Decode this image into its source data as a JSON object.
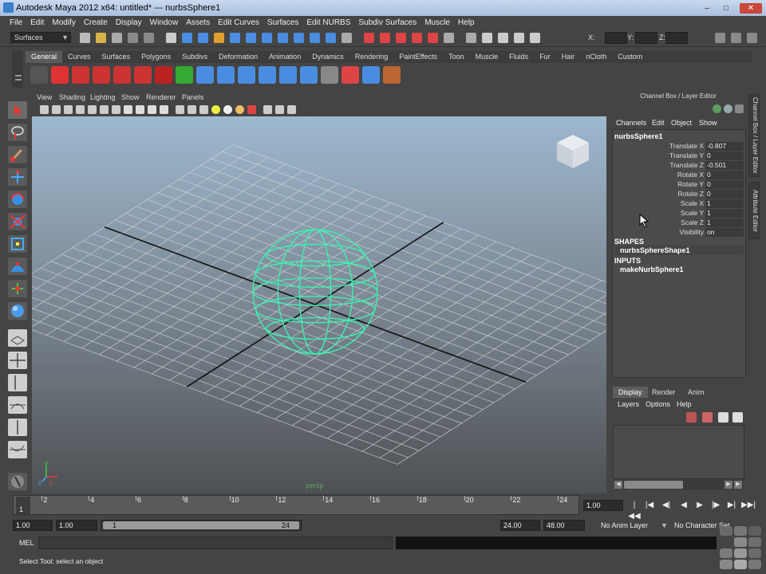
{
  "window": {
    "title": "Autodesk Maya 2012 x64: untitled*   ---   nurbsSphere1",
    "controls": [
      "minimize-icon",
      "maximize-icon",
      "close-icon"
    ]
  },
  "menubar": [
    "File",
    "Edit",
    "Modify",
    "Create",
    "Display",
    "Window",
    "Assets",
    "Edit Curves",
    "Surfaces",
    "Edit NURBS",
    "Subdiv Surfaces",
    "Muscle",
    "Help"
  ],
  "statusline": {
    "menuset": "Surfaces",
    "coord_labels": [
      "X:",
      "Y:",
      "Z:"
    ]
  },
  "shelf": {
    "tabs": [
      "General",
      "Curves",
      "Surfaces",
      "Polygons",
      "Subdivs",
      "Deformation",
      "Animation",
      "Dynamics",
      "Rendering",
      "PaintEffects",
      "Toon",
      "Muscle",
      "Fluids",
      "Fur",
      "Hair",
      "nCloth",
      "Custom"
    ],
    "active_tab": "General"
  },
  "panel": {
    "menu": [
      "View",
      "Shading",
      "Lighting",
      "Show",
      "Renderer",
      "Panels"
    ],
    "camera_label": "persp"
  },
  "channel_box": {
    "header": "Channel Box / Layer Editor",
    "menu": [
      "Channels",
      "Edit",
      "Object",
      "Show"
    ],
    "object": "nurbsSphere1",
    "attributes": [
      {
        "label": "Translate X",
        "value": "-0.807"
      },
      {
        "label": "Translate Y",
        "value": "0"
      },
      {
        "label": "Translate Z",
        "value": "-0.501"
      },
      {
        "label": "Rotate X",
        "value": "0"
      },
      {
        "label": "Rotate Y",
        "value": "0"
      },
      {
        "label": "Rotate Z",
        "value": "0"
      },
      {
        "label": "Scale X",
        "value": "1"
      },
      {
        "label": "Scale Y",
        "value": "1"
      },
      {
        "label": "Scale Z",
        "value": "1"
      },
      {
        "label": "Visibility",
        "value": "on"
      }
    ],
    "shapes_header": "SHAPES",
    "shape_node": "nurbsSphereShape1",
    "inputs_header": "INPUTS",
    "input_node": "makeNurbSphere1"
  },
  "side_tabs": [
    "Channel Box / Layer Editor",
    "Attribute Editor"
  ],
  "layer_editor": {
    "tabs": [
      "Display",
      "Render",
      "Anim"
    ],
    "active_tab": "Display",
    "menu": [
      "Layers",
      "Options",
      "Help"
    ]
  },
  "timeline": {
    "ticks": [
      "1",
      "2",
      "4",
      "6",
      "8",
      "10",
      "12",
      "14",
      "16",
      "18",
      "20",
      "22",
      "24"
    ],
    "current_frame": "1.00"
  },
  "range": {
    "start": "1.00",
    "inner_start": "1.00",
    "slider_start": "1",
    "slider_end": "24",
    "end": "24.00",
    "outer_end": "48.00",
    "anim_layer": "No Anim Layer",
    "character_set": "No Character Set"
  },
  "command": {
    "label": "MEL"
  },
  "help_line": "Select Tool: select an object",
  "colors": {
    "ui_bg": "#444444",
    "wireframe": "#3df0b0",
    "viewport_top": "#9eb8cf",
    "viewport_bottom": "#4e5154"
  }
}
